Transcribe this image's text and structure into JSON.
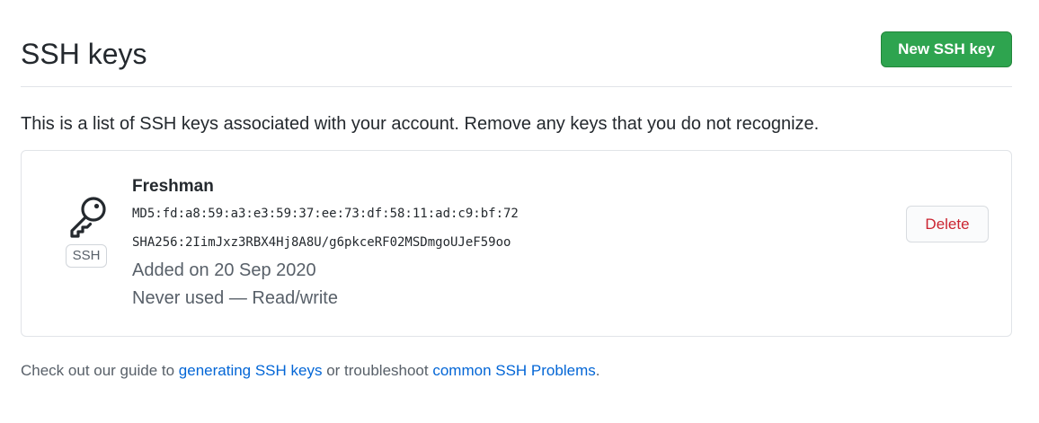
{
  "header": {
    "title": "SSH keys",
    "new_key_button": "New SSH key"
  },
  "intro": "This is a list of SSH keys associated with your account. Remove any keys that you do not recognize.",
  "keys": [
    {
      "type_label": "SSH",
      "title": "Freshman",
      "md5": "MD5:fd:a8:59:a3:e3:59:37:ee:73:df:58:11:ad:c9:bf:72",
      "sha256": "SHA256:2IimJxz3RBX4Hj8A8U/g6pkceRF02MSDmgoUJeF59oo",
      "added": "Added on 20 Sep 2020",
      "usage": "Never used — Read/write",
      "delete_label": "Delete"
    }
  ],
  "footer": {
    "prefix": "Check out our guide to ",
    "link1": "generating SSH keys",
    "middle": " or troubleshoot ",
    "link2": "common SSH Problems",
    "suffix": "."
  },
  "colors": {
    "primary_button": "#2ea44f",
    "danger_text": "#cb2431",
    "link": "#0366d6",
    "muted_text": "#586069",
    "border": "#e1e4e8"
  },
  "icons": {
    "key": "key-icon"
  }
}
